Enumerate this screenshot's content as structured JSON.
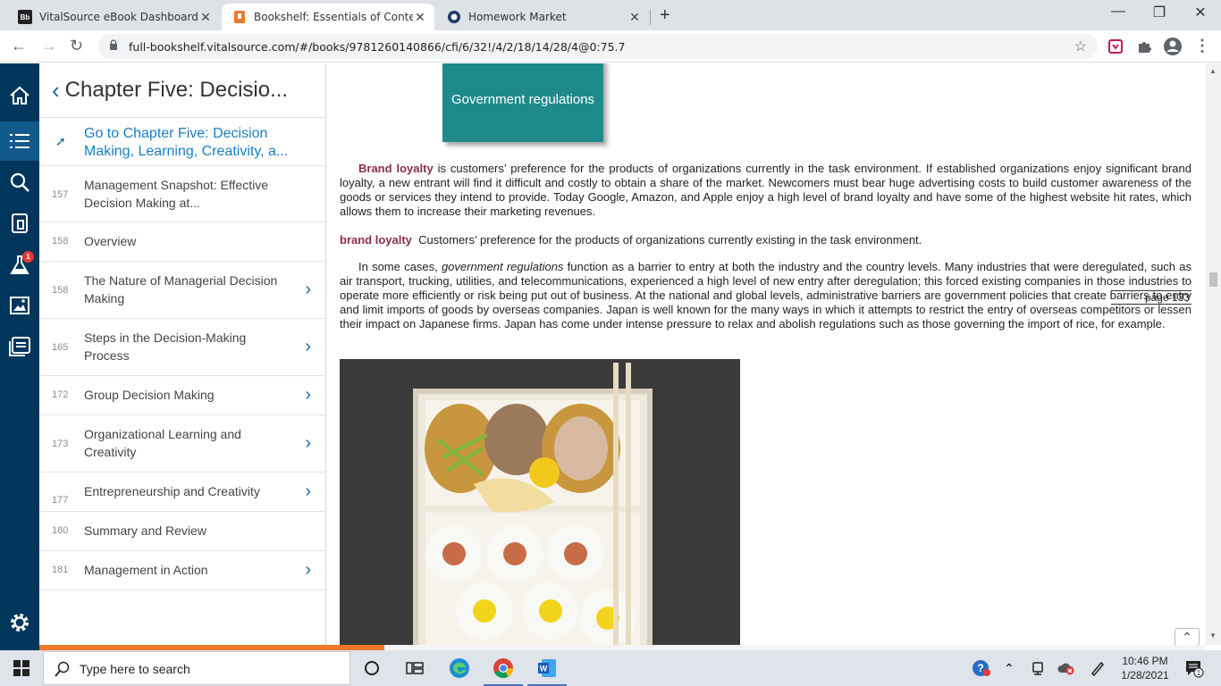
{
  "browser": {
    "tabs": [
      {
        "title": "VitalSource eBook Dashboard – E",
        "favicon": "Bb"
      },
      {
        "title": "Bookshelf: Essentials of Contemp",
        "favicon": "bookshelf-icon"
      },
      {
        "title": "Homework Market",
        "favicon": "homework-market-icon"
      }
    ],
    "url": "full-bookshelf.vitalsource.com/#/books/9781260140866/cfi/6/32!/4/2/18/14/28/4@0:75.7"
  },
  "rail": {
    "notification_count": "1"
  },
  "toc": {
    "header_title": "Chapter Five: Decisio...",
    "goto_label": "Go to Chapter Five: Decision Making, Learning, Creativity, a...",
    "items": [
      {
        "page": "157",
        "label": "Management Snapshot: Effective Decision Making at...",
        "has_children": false
      },
      {
        "page": "158",
        "label": "Overview",
        "has_children": false
      },
      {
        "page": "158",
        "label": "The Nature of Managerial Decision Making",
        "has_children": true
      },
      {
        "page": "165",
        "label": "Steps in the Decision-Making Process",
        "has_children": true
      },
      {
        "page": "172",
        "label": "Group Decision Making",
        "has_children": true
      },
      {
        "page": "173",
        "label": "Organizational Learning and Creativity",
        "has_children": true
      },
      {
        "page": "177",
        "label": "Entrepreneurship and Creativity",
        "has_children": true
      },
      {
        "page": "180",
        "label": "Summary and Review",
        "has_children": false
      },
      {
        "page": "181",
        "label": "Management in Action",
        "has_children": true
      }
    ]
  },
  "content": {
    "callout": "Government regulations",
    "p1_term": "Brand loyalty",
    "p1_text": " is customers’ preference for the products of organizations currently in the task environment. If established organizations enjoy significant brand loyalty, a new entrant will find it difficult and costly to obtain a share of the market. Newcomers must bear huge advertising costs to build customer awareness of the goods or services they intend to provide. Today Google, Amazon, and Apple enjoy a high level of brand loyalty and have some of the highest website hit rates, which allows them to increase their marketing revenues.",
    "def_term": "brand loyalty",
    "def_text": "Customers’ preference for the products of organizations currently existing in the task environment.",
    "p3_start": "In some cases, ",
    "p3_italic": "government regulations",
    "p3_text": " function as a barrier to entry at both the industry and the country levels. Many industries that were deregulated, such as air transport, trucking, utilities, and telecommunications, experienced a high level of new entry after deregulation; this forced existing companies in those industries to operate more efficiently or risk being put out of business. At the national and global levels, administrative barriers are government policies that create barriers to entry and limit imports of goods by overseas companies. Japan is well known for the many ways in which it attempts to restrict the entry of overseas competitors or lessen their impact on Japanese firms. Japan has come under intense pressure to relax and abolish regulations such as those governing the import of rice, for example.",
    "page_marker": "page 133",
    "reading_progress": 0.296
  },
  "taskbar": {
    "search_placeholder": "Type here to search",
    "time": "10:46 PM",
    "date": "1/28/2021",
    "notification_count": "1"
  }
}
